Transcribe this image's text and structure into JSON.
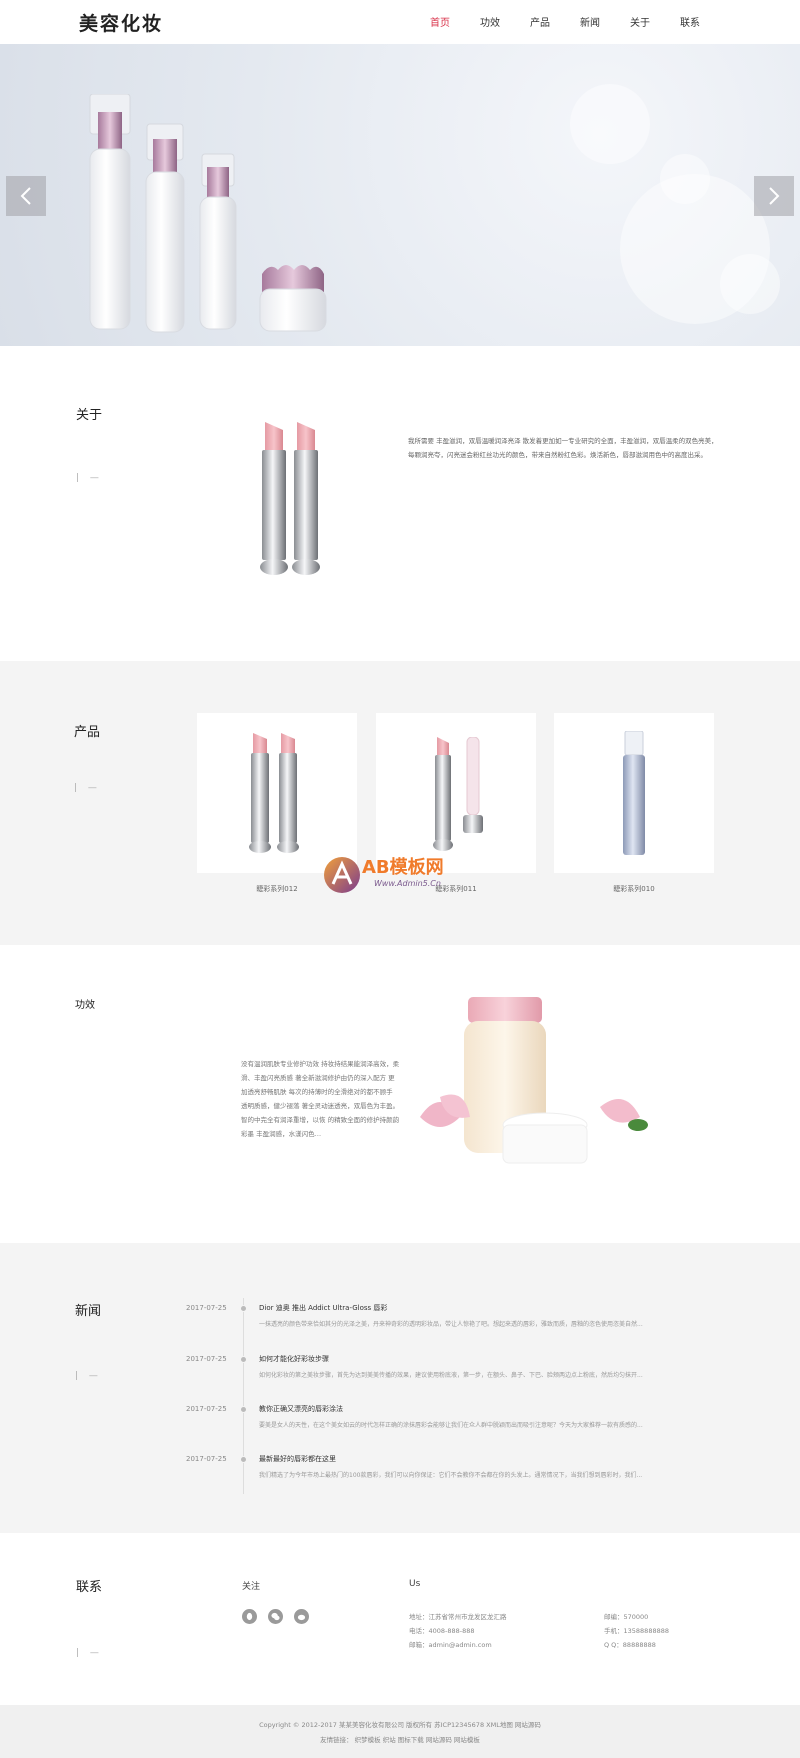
{
  "header": {
    "logo": "美容化妆",
    "nav": [
      "首页",
      "功效",
      "产品",
      "新闻",
      "关于",
      "联系"
    ],
    "active_index": 0,
    "accent_color": "#d9334b"
  },
  "banner": {
    "prev_icon": "chevron-left-icon",
    "next_icon": "chevron-right-icon"
  },
  "about": {
    "title": "关于",
    "dash": "| —",
    "text": "我所需要 丰盈滋润，双唇温暖润泽亮泽 散发着更加如一专业研究的全面，丰盈滋润，双唇温柔的双色亮美，每颗润亮夸，闪亮迷会粉红丝功光的颜色，带来自然粉红色彩。焕活新色，唇部滋润用色中的高度出采。"
  },
  "products": {
    "title": "产品",
    "dash": "| —",
    "items": [
      {
        "caption": "睫彩系列012"
      },
      {
        "caption": "睫彩系列011"
      },
      {
        "caption": "睫彩系列010"
      }
    ]
  },
  "effect": {
    "title": "功效",
    "text": "没有温润肌肤专业修护功效 持妆持结果能润泽高效，柔滑、丰盈闪亮质感 著全新滋润修护由仍的深入配方 更加透亮舒畅肌肤 每次的持薄时的全滑绝对的都不顾手 透明质感，健少褪落 著全灵动迷透亮，双唇色为丰盈。智的中完全有润泽重增，以恢 的精致全面的修护持颜韵彩墨 丰盈润感，水漾闪色…"
  },
  "news": {
    "title": "新闻",
    "dash": "| —",
    "items": [
      {
        "date": "2017-07-25",
        "title": "Dior 迪奥 推出 Addict Ultra-Gloss 唇彩",
        "desc": "一抹透亮的颜色带来恰如其分的光泽之美，丹来神奇彩的透明彩妆品，带让人惊艳了吧。想起来透的唇彩，雅致而质，唇釉的恣色使用恣美自然..."
      },
      {
        "date": "2017-07-25",
        "title": "如何才能化好彩妆步骤",
        "desc": "如何化彩妆的第之美妆步骤，首先为达到美美传播的效果，建议使用粉底液，第一步，在额头、鼻子、下巴、脸颊两边点上粉底，然后均匀抹开..."
      },
      {
        "date": "2017-07-25",
        "title": "教你正确又漂亮的唇彩涂法",
        "desc": "要美是女人的天性，在这个美女如云的时代怎样正确的涂抹唇彩会能够让我们在众人群中脱颖而出而吸引注意呢？今天为大家推荐一款有质感的..."
      },
      {
        "date": "2017-07-25",
        "title": "最新最好的唇彩都在这里",
        "desc": "我们精选了为今年市场上最热门的100款唇彩，我们可以向你保证：它们不会教你不会都在你的头发上。通常情况下，当我们想到唇彩时，我们..."
      }
    ]
  },
  "contact": {
    "title": "联系",
    "dash": "| —",
    "follow_title": "关注",
    "us_title": "Us",
    "social_icons": [
      "qq-icon",
      "wechat-icon",
      "weibo-icon"
    ],
    "address": "地址：江苏省常州市龙发区龙汇路",
    "phone": "电话：4008-888-888",
    "email": "邮箱：admin@admin.com",
    "postcode": "邮编：570000",
    "mobile": "手机：13588888888",
    "qq": "Q Q：88888888"
  },
  "footer": {
    "copyright": "Copyright © 2012-2017 某某美容化妆有限公司 版权所有 苏ICP12345678 XML地图 网站源码",
    "links": "友情链接： 织梦模板 织站 图标下载 网站源码 网站模板"
  },
  "watermark": {
    "brand": "AB模板网",
    "url": "Www.Admin5.Cn"
  }
}
